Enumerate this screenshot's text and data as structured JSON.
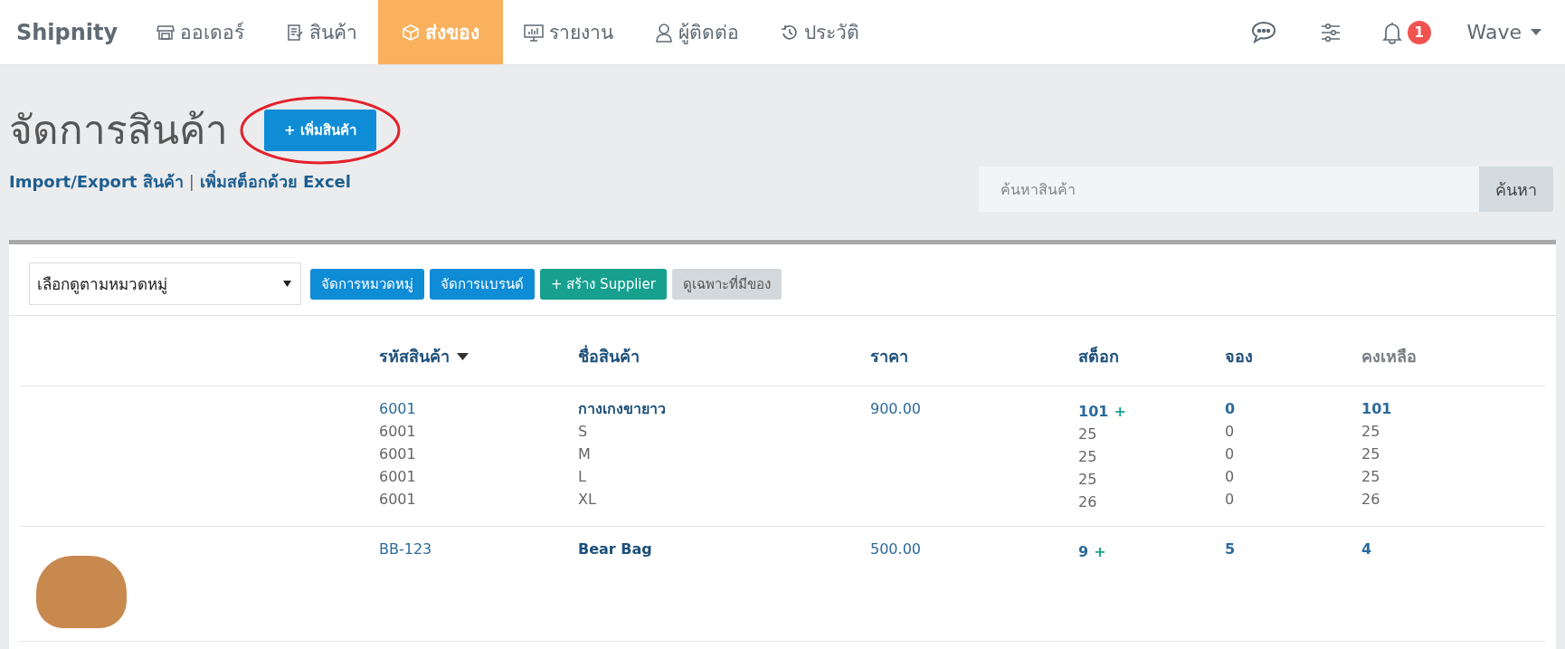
{
  "navbar": {
    "brand": "Shipnity",
    "items": [
      {
        "label": "ออเดอร์",
        "selected": false
      },
      {
        "label": "สินค้า",
        "selected": false
      },
      {
        "label": "ส่งของ",
        "selected": true
      },
      {
        "label": "รายงาน",
        "selected": false
      },
      {
        "label": "ผู้ติดต่อ",
        "selected": false
      },
      {
        "label": "ประวัติ",
        "selected": false
      }
    ],
    "notification_count": "1",
    "user": "Wave"
  },
  "header": {
    "title": "จัดการสินค้า",
    "add_button": {
      "label": "+ เพิ่มสินค้า",
      "highlighted": true
    },
    "links": [
      "Import/Export สินค้า",
      "เพิ่มสต็อกด้วย Excel"
    ],
    "link_separator": "|",
    "search": {
      "placeholder": "ค้นหาสินค้า",
      "button": "ค้นหา"
    }
  },
  "toolbar": {
    "category_select": "เลือกดูตามหมวดหมู่",
    "buttons": [
      {
        "label": "จัดการหมวดหมู่",
        "kind": "primary"
      },
      {
        "label": "จัดการแบรนด์",
        "kind": "primary"
      },
      {
        "label": "+ สร้าง Supplier",
        "kind": "success"
      },
      {
        "label": "ดูเฉพาะที่มีของ",
        "kind": "default"
      }
    ]
  },
  "table": {
    "columns": [
      {
        "label": "รหัสสินค้า",
        "sorted": true,
        "kind": "link"
      },
      {
        "label": "ชื่อสินค้า",
        "sorted": false,
        "kind": "link"
      },
      {
        "label": "ราคา",
        "sorted": false,
        "kind": "link"
      },
      {
        "label": "สต็อก",
        "sorted": false,
        "kind": "link"
      },
      {
        "label": "จอง",
        "sorted": false,
        "kind": "link"
      },
      {
        "label": "คงเหลือ",
        "sorted": false,
        "kind": "plain"
      }
    ],
    "rows": [
      {
        "has_photo": false,
        "code": "6001",
        "name": "กางเกงขายาว",
        "price": "900.00",
        "stock": "101",
        "stock_add": "+",
        "reserved": "0",
        "remaining": "101",
        "variants": [
          {
            "code": "6001",
            "name": "S",
            "stock": "25",
            "reserved": "0",
            "remaining": "25"
          },
          {
            "code": "6001",
            "name": "M",
            "stock": "25",
            "reserved": "0",
            "remaining": "25"
          },
          {
            "code": "6001",
            "name": "L",
            "stock": "25",
            "reserved": "0",
            "remaining": "25"
          },
          {
            "code": "6001",
            "name": "XL",
            "stock": "26",
            "reserved": "0",
            "remaining": "26"
          }
        ]
      },
      {
        "has_photo": true,
        "code": "BB-123",
        "name": "Bear Bag",
        "price": "500.00",
        "stock": "9",
        "stock_add": "+",
        "reserved": "5",
        "remaining": "4",
        "variants": []
      }
    ]
  }
}
